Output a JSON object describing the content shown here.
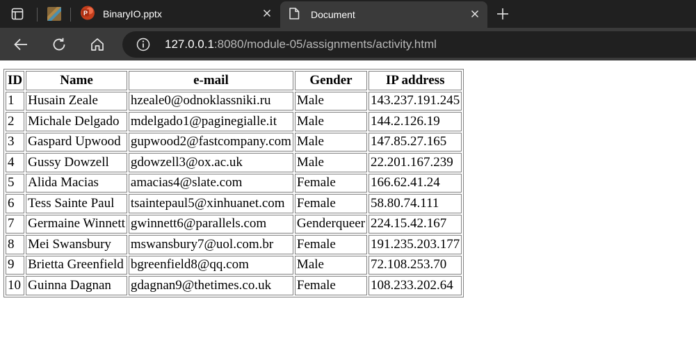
{
  "browser": {
    "tabs": [
      {
        "title": "BinaryIO.pptx",
        "icon": "powerpoint-icon",
        "active": false
      },
      {
        "title": "Document",
        "icon": "document-icon",
        "active": true
      }
    ],
    "address": {
      "host": "127.0.0.1",
      "rest": ":8080/module-05/assignments/activity.html"
    },
    "colors": {
      "strip": "#202020",
      "toolbar": "#3a3a3a",
      "accent_ppt": "#c43e1c"
    }
  },
  "table": {
    "headers": [
      "ID",
      "Name",
      "e-mail",
      "Gender",
      "IP address"
    ],
    "rows": [
      [
        "1",
        "Husain Zeale",
        "hzeale0@odnoklassniki.ru",
        "Male",
        "143.237.191.245"
      ],
      [
        "2",
        "Michale Delgado",
        "mdelgado1@paginegialle.it",
        "Male",
        "144.2.126.19"
      ],
      [
        "3",
        "Gaspard Upwood",
        "gupwood2@fastcompany.com",
        "Male",
        "147.85.27.165"
      ],
      [
        "4",
        "Gussy Dowzell",
        "gdowzell3@ox.ac.uk",
        "Male",
        "22.201.167.239"
      ],
      [
        "5",
        "Alida Macias",
        "amacias4@slate.com",
        "Female",
        "166.62.41.24"
      ],
      [
        "6",
        "Tess Sainte Paul",
        "tsaintepaul5@xinhuanet.com",
        "Female",
        "58.80.74.111"
      ],
      [
        "7",
        "Germaine Winnett",
        "gwinnett6@parallels.com",
        "Genderqueer",
        "224.15.42.167"
      ],
      [
        "8",
        "Mei Swansbury",
        "mswansbury7@uol.com.br",
        "Female",
        "191.235.203.177"
      ],
      [
        "9",
        "Brietta Greenfield",
        "bgreenfield8@qq.com",
        "Male",
        "72.108.253.70"
      ],
      [
        "10",
        "Guinna Dagnan",
        "gdagnan9@thetimes.co.uk",
        "Female",
        "108.233.202.64"
      ]
    ]
  }
}
